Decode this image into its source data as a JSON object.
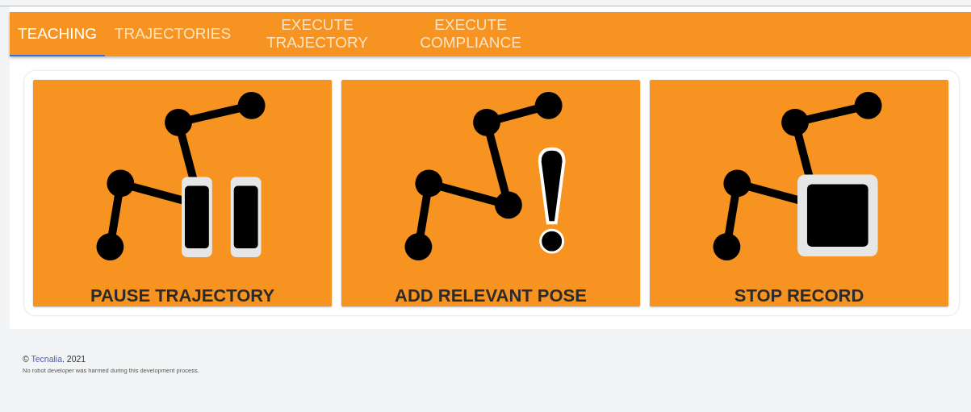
{
  "tabs": [
    {
      "label": "TEACHING",
      "selected": true
    },
    {
      "label": "TRAJECTORIES",
      "selected": false
    },
    {
      "label": "EXECUTE TRAJECTORY",
      "selected": false
    },
    {
      "label": "EXECUTE COMPLIANCE",
      "selected": false
    }
  ],
  "actions": [
    {
      "kind": "pause",
      "label": "PAUSE TRAJECTORY"
    },
    {
      "kind": "pose",
      "label": "ADD RELEVANT POSE"
    },
    {
      "kind": "stop",
      "label": "STOP RECORD"
    }
  ],
  "footer": {
    "copyright": "©",
    "link": "Tecnalia",
    "suffix": ". 2021",
    "note": "No robot developer was harmed during this development process."
  }
}
